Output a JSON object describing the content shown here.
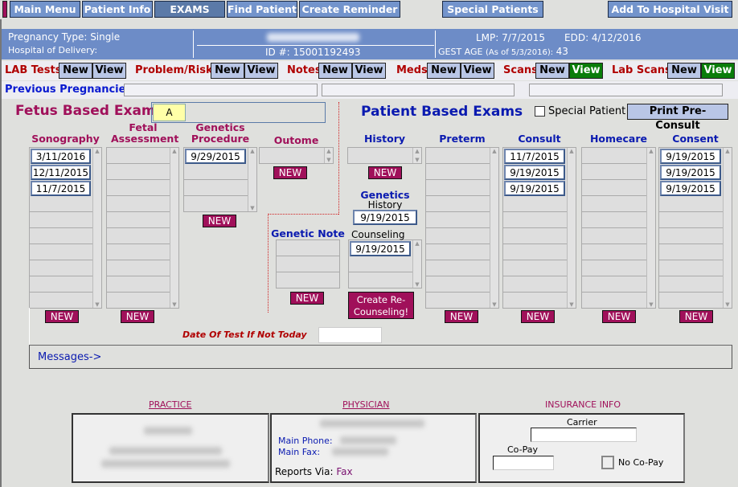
{
  "nav": {
    "main_menu": "Main Menu",
    "patient_info": "Patient Info",
    "exams": "EXAMS",
    "find_patient": "Find Patient",
    "create_reminder": "Create Reminder",
    "special_patients": "Special Patients",
    "add_hospital_visit": "Add To Hospital Visit"
  },
  "banner": {
    "pregnancy_type": "Pregnancy Type: Single",
    "hospital": "Hospital of Delivery:",
    "id": "ID #: 15001192493",
    "lmp": "LMP: 7/7/2015",
    "edd": "EDD: 4/12/2016",
    "gest_age_label": "GEST AGE",
    "gest_age_asof": "(As of 5/3/2016):",
    "gest_age_value": "43"
  },
  "actions": {
    "lab_tests": "LAB Tests",
    "problem_risk": "Problem/Risk",
    "notes": "Notes",
    "meds": "Meds",
    "scans": "Scans",
    "lab_scans": "Lab Scans",
    "new": "New",
    "view": "View"
  },
  "previous_pregnancies": "Previous Pregnancies",
  "fetus": {
    "title": "Fetus Based Exams",
    "fetus_id": "A"
  },
  "patient": {
    "title": "Patient Based Exams",
    "special_patient": "Special Patient",
    "special_patient_checked": false,
    "print_preconsult": "Print Pre-Consult"
  },
  "columns": {
    "sonography": {
      "label": "Sonography",
      "dates": [
        "3/11/2016",
        "12/11/2015",
        "11/7/2015"
      ]
    },
    "fetal": {
      "label": "Fetal Assessment",
      "dates": []
    },
    "genproc": {
      "label": "Genetics Procedure",
      "dates": [
        "9/29/2015"
      ]
    },
    "outcome": {
      "label": "Outome",
      "dates": []
    },
    "history": {
      "label": "History",
      "dates": []
    },
    "preterm": {
      "label": "Preterm",
      "dates": []
    },
    "consult": {
      "label": "Consult",
      "dates": [
        "11/7/2015",
        "9/19/2015",
        "9/19/2015"
      ]
    },
    "homecare": {
      "label": "Homecare",
      "dates": []
    },
    "consent": {
      "label": "Consent",
      "dates": [
        "9/19/2015",
        "9/19/2015",
        "9/19/2015"
      ]
    },
    "geneticnote": {
      "label": "Genetic Note",
      "dates": []
    }
  },
  "genetics": {
    "title": "Genetics",
    "history_label": "History",
    "history_date": "9/19/2015",
    "counseling_label": "Counseling",
    "counseling_dates": [
      "9/19/2015"
    ],
    "recounsel": "Create Re-Counseling!"
  },
  "new_label": "NEW",
  "date_of_test_label": "Date Of Test If Not Today",
  "date_of_test_value": "",
  "messages": "Messages->",
  "bottom": {
    "practice": "PRACTICE",
    "physician": "PHYSICIAN",
    "insurance": "INSURANCE INFO",
    "main_phone": "Main Phone:",
    "main_fax": "Main Fax:",
    "reports_via": "Reports Via:",
    "reports_via_value": "Fax",
    "carrier": "Carrier",
    "copay": "Co-Pay",
    "no_copay": "No Co-Pay"
  }
}
